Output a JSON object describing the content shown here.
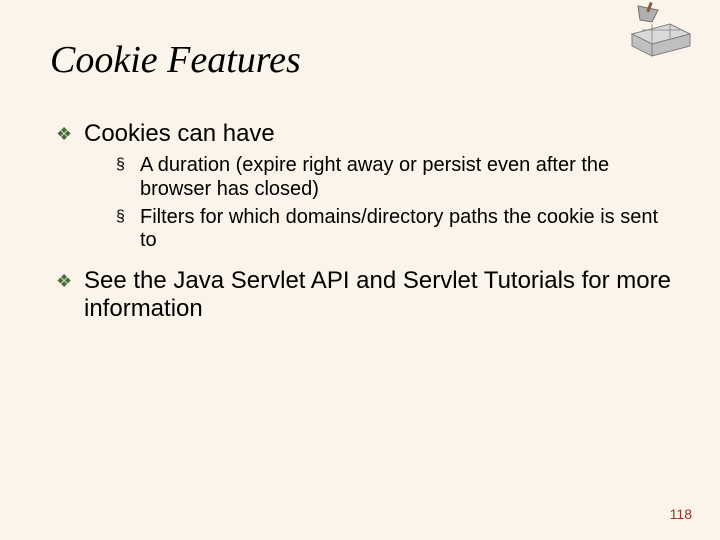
{
  "title": "Cookie Features",
  "points": {
    "p1": {
      "label": "Cookies can have",
      "sub": {
        "s1": "A duration (expire right away or persist even after the browser has closed)",
        "s2": "Filters for which domains/directory paths the cookie is sent to"
      }
    },
    "p2": {
      "label": "See the Java Servlet API and Servlet Tutorials for more information"
    }
  },
  "bullets": {
    "lvl1": "❖",
    "lvl2": "§"
  },
  "page_number": "118"
}
